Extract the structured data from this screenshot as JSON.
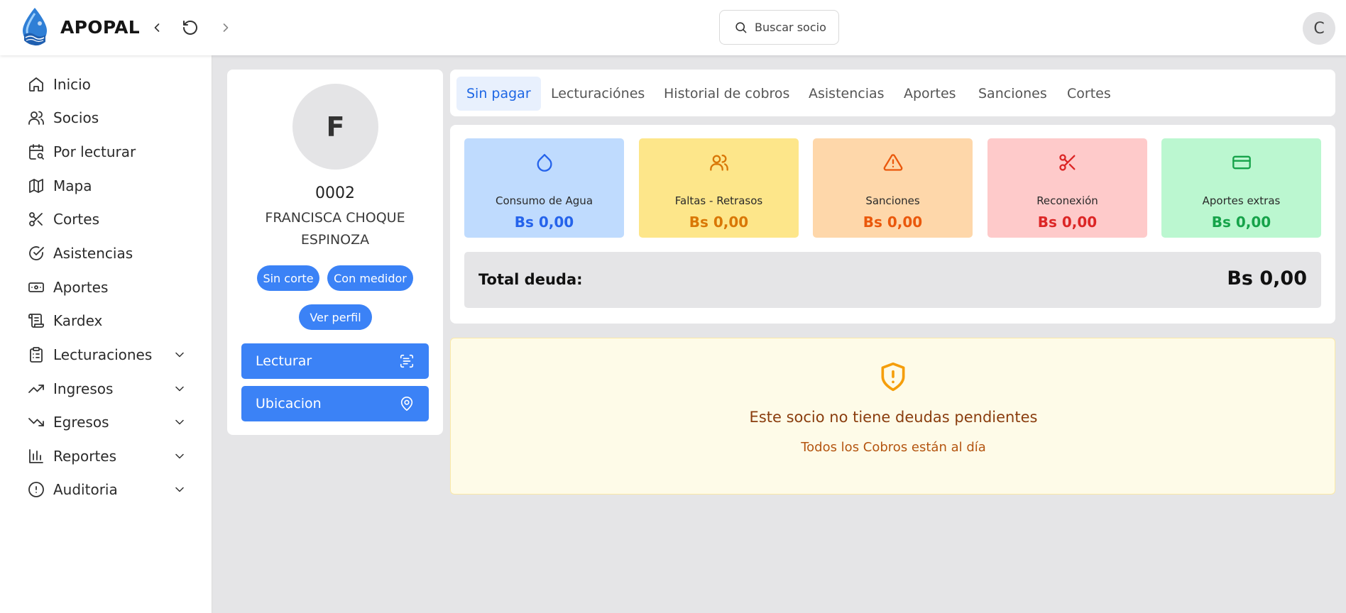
{
  "app": {
    "title": "APOPAL"
  },
  "search": {
    "placeholder": "Buscar socio"
  },
  "user": {
    "initial": "C"
  },
  "sidebar": {
    "items": [
      {
        "label": "Inicio",
        "icon": "home-icon"
      },
      {
        "label": "Socios",
        "icon": "users-icon"
      },
      {
        "label": "Por lecturar",
        "icon": "calendar-search-icon"
      },
      {
        "label": "Mapa",
        "icon": "map-icon"
      },
      {
        "label": "Cortes",
        "icon": "scissors-icon"
      },
      {
        "label": "Asistencias",
        "icon": "check-circle-icon"
      },
      {
        "label": "Aportes",
        "icon": "banknote-icon"
      },
      {
        "label": "Kardex",
        "icon": "scroll-icon"
      },
      {
        "label": "Lecturaciones",
        "icon": "clipboard-icon",
        "expandable": true
      },
      {
        "label": "Ingresos",
        "icon": "trending-up-icon",
        "expandable": true
      },
      {
        "label": "Egresos",
        "icon": "trending-down-icon",
        "expandable": true
      },
      {
        "label": "Reportes",
        "icon": "bar-chart-icon",
        "expandable": true
      },
      {
        "label": "Auditoria",
        "icon": "alert-circle-icon",
        "expandable": true
      }
    ]
  },
  "profile": {
    "initial": "F",
    "code": "0002",
    "name": "FRANCISCA CHOQUE ESPINOZA",
    "badges": [
      "Sin corte",
      "Con medidor"
    ],
    "view_profile": "Ver perfil",
    "actions": [
      {
        "label": "Lecturar",
        "icon": "scan-text-icon"
      },
      {
        "label": "Ubicacion",
        "icon": "map-pin-icon"
      }
    ]
  },
  "tabs": [
    {
      "label": "Sin pagar",
      "active": true
    },
    {
      "label": "Lecturaciónes",
      "active": false
    },
    {
      "label": "Historial de cobros",
      "active": false
    },
    {
      "label": "Asistencias",
      "active": false
    },
    {
      "label": "Aportes",
      "active": false
    },
    {
      "label": "Sanciones",
      "active": false
    },
    {
      "label": "Cortes",
      "active": false
    }
  ],
  "debt_cards": [
    {
      "label": "Consumo de Agua",
      "value": "Bs 0,00",
      "icon": "droplet-icon",
      "bg": "#bfdbfe",
      "color": "#2563eb"
    },
    {
      "label": "Faltas - Retrasos",
      "value": "Bs 0,00",
      "icon": "users-icon",
      "bg": "#fde68a",
      "color": "#d97706"
    },
    {
      "label": "Sanciones",
      "value": "Bs 0,00",
      "icon": "warning-triangle-icon",
      "bg": "#fed7aa",
      "color": "#ea580c"
    },
    {
      "label": "Reconexión",
      "value": "Bs 0,00",
      "icon": "scissors-icon",
      "bg": "#fecaca",
      "color": "#dc2626"
    },
    {
      "label": "Aportes extras",
      "value": "Bs 0,00",
      "icon": "credit-card-icon",
      "bg": "#bbf7d0",
      "color": "#16a34a"
    }
  ],
  "total": {
    "label": "Total deuda:",
    "value": "Bs 0,00"
  },
  "notice": {
    "icon": "shield-alert-icon",
    "title": "Este socio no tiene deudas pendientes",
    "subtitle": "Todos los Cobros están al día"
  },
  "colors": {
    "primary": "#3b82f6",
    "active_tab_text": "#1d66e4"
  }
}
